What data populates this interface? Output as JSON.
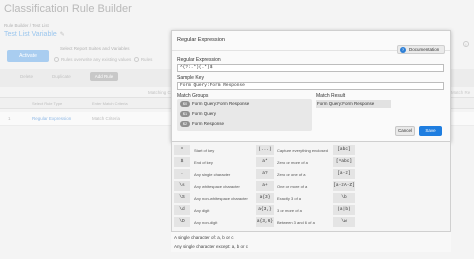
{
  "background": {
    "app_title": "Classification Rule Builder",
    "breadcrumb": "Rule Builder / Test List",
    "rule_name": "Test List Variable",
    "activate_label": "Activate",
    "report_suites_label": "Select Report Suites and Variables",
    "radio_option_1": "Rules overwrite any existing values",
    "radio_option_2": "Rules",
    "toolbar": {
      "delete": "Delete",
      "duplicate": "Duplicate",
      "add_rule": "Add Rule"
    },
    "matching_header": "Matching Cr",
    "match_result_header": "Match Re",
    "grid_headers": {
      "rule_type": "Select Rule Type",
      "criteria": "Enter Match Criteria"
    },
    "grid_row": {
      "num": "1",
      "type": "Regular Expression",
      "criteria": "Match Criteria"
    }
  },
  "modal": {
    "title": "Regular Expression",
    "documentation_label": "Documentation",
    "regex_label": "Regular Expression",
    "regex_value": "^(?:.*)(.*)$",
    "sample_key_label": "Sample Key",
    "sample_key_value": "Form Query:Form Response",
    "match_groups_label": "Match Groups",
    "match_groups": [
      {
        "badge": "$0",
        "value": "Form Query:Form Response"
      },
      {
        "badge": "$1",
        "value": "Form Query"
      },
      {
        "badge": "$2",
        "value": "Form Response"
      }
    ],
    "match_result_label": "Match Result",
    "match_result_value": "Form Query:Form Response",
    "cancel_label": "Cancel",
    "save_label": "Save"
  },
  "cheat_sheet": {
    "columns": [
      [
        {
          "sym": "^",
          "desc": "Start of key"
        },
        {
          "sym": "$",
          "desc": "End of key"
        },
        {
          "sym": ".",
          "desc": "Any single character"
        },
        {
          "sym": "\\s",
          "desc": "Any whitespace character"
        },
        {
          "sym": "\\S",
          "desc": "Any non-whitespace character"
        },
        {
          "sym": "\\d",
          "desc": "Any digit"
        },
        {
          "sym": "\\D",
          "desc": "Any non-digit"
        }
      ],
      [
        {
          "sym": "(...)",
          "desc": "Capture everything enclosed"
        },
        {
          "sym": "a*",
          "desc": "Zero or more of a"
        },
        {
          "sym": "a?",
          "desc": "Zero or one of a"
        },
        {
          "sym": "a+",
          "desc": "One or more of a"
        },
        {
          "sym": "a{3}",
          "desc": "Exactly 3 of a"
        },
        {
          "sym": "a{3,}",
          "desc": "3 or more of a"
        },
        {
          "sym": "a{3,6}",
          "desc": "Between 3 and 6 of a"
        }
      ],
      [
        {
          "sym": "[abc]",
          "desc": ""
        },
        {
          "sym": "[^abc]",
          "desc": ""
        },
        {
          "sym": "[a-z]",
          "desc": ""
        },
        {
          "sym": "[a-zA-Z]",
          "desc": ""
        },
        {
          "sym": "\\b",
          "desc": ""
        },
        {
          "sym": "(a|b)",
          "desc": ""
        },
        {
          "sym": "\\w",
          "desc": ""
        }
      ]
    ],
    "footer_line_1": "A single character of: a, b or c",
    "footer_line_2": "Any single character except: a, b or c"
  }
}
